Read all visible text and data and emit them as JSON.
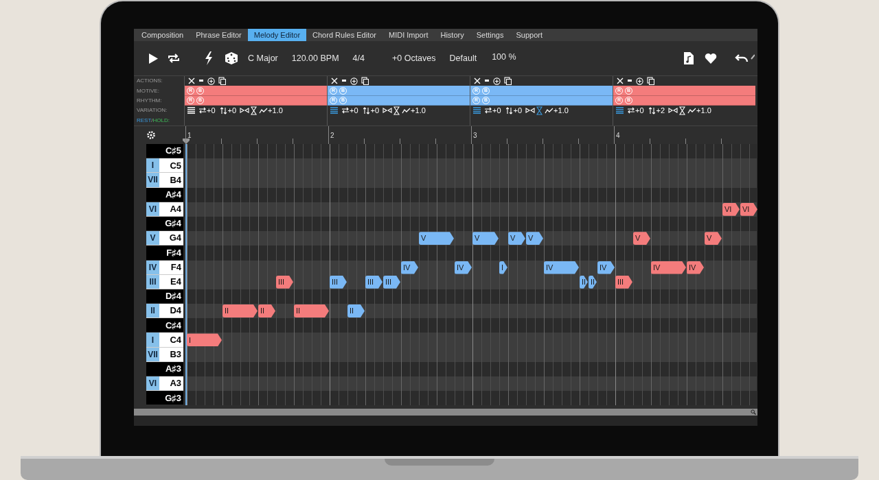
{
  "tabs": [
    {
      "label": "Composition",
      "selected": false
    },
    {
      "label": "Phrase Editor",
      "selected": false
    },
    {
      "label": "Melody Editor",
      "selected": true
    },
    {
      "label": "Chord Rules Editor",
      "selected": false
    },
    {
      "label": "MIDI Import",
      "selected": false
    },
    {
      "label": "History",
      "selected": false
    },
    {
      "label": "Settings",
      "selected": false
    },
    {
      "label": "Support",
      "selected": false
    }
  ],
  "toolbar": {
    "key": "C Major",
    "tempo": "120.00 BPM",
    "time_signature": "4/4",
    "octaves": "+0 Octaves",
    "style": "Default",
    "volume": "100 %"
  },
  "track_labels": {
    "actions": "ACTIONS:",
    "motive": "MOTIVE:",
    "rhythm": "RHYTHM:",
    "variation": "VARIATION:",
    "rest": "REST",
    "separator": "/",
    "hold": "HOLD:"
  },
  "measures": [
    {
      "number": "1",
      "color": "#f47c7c",
      "motive": [
        "R",
        "B"
      ],
      "rhythm": [
        "R",
        "B"
      ],
      "variation": {
        "list_active": false,
        "swap": "+0",
        "shift": "+0",
        "hourglass_active": false,
        "curve": "+1.0"
      }
    },
    {
      "number": "2",
      "color": "#7ab8f5",
      "motive": [
        "R",
        "B"
      ],
      "rhythm": [
        "R",
        "B"
      ],
      "variation": {
        "list_active": true,
        "swap": "+0",
        "shift": "+0",
        "hourglass_active": false,
        "curve": "+1.0"
      }
    },
    {
      "number": "3",
      "color": "#7ab8f5",
      "motive": [
        "R",
        "B"
      ],
      "rhythm": [
        "R",
        "B"
      ],
      "variation": {
        "list_active": true,
        "swap": "+0",
        "shift": "+0",
        "hourglass_active": true,
        "curve": "+1.0"
      }
    },
    {
      "number": "4",
      "color": "#f47c7c",
      "motive": [
        "R",
        "B"
      ],
      "rhythm": [
        "R",
        "B"
      ],
      "variation": {
        "list_active": true,
        "swap": "+0",
        "shift": "+2",
        "hourglass_active": false,
        "curve": "+1.0"
      }
    }
  ],
  "piano_keys": [
    {
      "note": "C♯5",
      "kind": "black"
    },
    {
      "note": "C5",
      "kind": "white",
      "degree": "I"
    },
    {
      "note": "B4",
      "kind": "white",
      "degree": "VII"
    },
    {
      "note": "A♯4",
      "kind": "black"
    },
    {
      "note": "A4",
      "kind": "white",
      "degree": "VI",
      "events": [
        {
          "kind": "measure-rest"
        },
        {
          "kind": "measure-rest"
        },
        {
          "kind": "measure-rest"
        },
        {
          "kind": "half-rest"
        },
        {
          "kind": "quarter-rest"
        },
        {
          "kind": "eighth-note",
          "label": "VI",
          "color": "#f47c7c"
        },
        {
          "kind": "eighth-note",
          "label": "VI",
          "color": "#f47c7c"
        }
      ]
    },
    {
      "note": "G♯4",
      "kind": "black"
    },
    {
      "note": "G4",
      "kind": "white",
      "degree": "V",
      "events": [
        {
          "kind": "measure-rest"
        },
        {
          "kind": "half-rest"
        },
        {
          "kind": "eighth-rest"
        },
        {
          "kind": "quarter-note",
          "label": "V",
          "color": "#7ab8f5"
        },
        {
          "kind": "eighth-rest"
        },
        {
          "kind": "dotted-eighth-note",
          "label": "V",
          "color": "#7ab8f5"
        },
        {
          "kind": "sixteenth-rest"
        },
        {
          "kind": "eighth-note",
          "label": "V",
          "color": "#7ab8f5"
        },
        {
          "kind": "eighth-note",
          "label": "V",
          "color": "#7ab8f5"
        },
        {
          "kind": "half-rest"
        },
        {
          "kind": "eighth-rest"
        },
        {
          "kind": "eighth-note",
          "label": "V",
          "color": "#f47c7c"
        },
        {
          "kind": "quarter-rest"
        },
        {
          "kind": "eighth-rest"
        },
        {
          "kind": "eighth-note",
          "label": "V",
          "color": "#f47c7c"
        }
      ]
    },
    {
      "note": "F♯4",
      "kind": "black"
    },
    {
      "note": "F4",
      "kind": "white",
      "degree": "IV",
      "events": [
        {
          "kind": "measure-rest"
        },
        {
          "kind": "half-rest"
        },
        {
          "kind": "eighth-note",
          "label": "IV",
          "color": "#7ab8f5"
        },
        {
          "kind": "quarter-rest"
        },
        {
          "kind": "eighth-note",
          "label": "IV",
          "color": "#7ab8f5"
        },
        {
          "kind": "eighth-rest"
        },
        {
          "kind": "sixteenth-rest"
        },
        {
          "kind": "sixteenth-note",
          "label": "I",
          "color": "#7ab8f5"
        },
        {
          "kind": "quarter-rest"
        },
        {
          "kind": "quarter-note",
          "label": "IV",
          "color": "#7ab8f5"
        },
        {
          "kind": "eighth-rest"
        },
        {
          "kind": "eighth-note",
          "label": "IV",
          "color": "#7ab8f5"
        },
        {
          "kind": "quarter-rest"
        },
        {
          "kind": "quarter-note",
          "label": "IV",
          "color": "#f47c7c"
        },
        {
          "kind": "eighth-note",
          "label": "IV",
          "color": "#f47c7c"
        }
      ]
    },
    {
      "note": "E4",
      "kind": "white",
      "degree": "III",
      "events": [
        {
          "kind": "half-rest"
        },
        {
          "kind": "eighth-rest"
        },
        {
          "kind": "eighth-note",
          "label": "III",
          "color": "#f47c7c"
        },
        {
          "kind": "quarter-rest"
        },
        {
          "kind": "eighth-note",
          "label": "III",
          "color": "#7ab8f5"
        },
        {
          "kind": "eighth-rest"
        },
        {
          "kind": "eighth-note",
          "label": "III",
          "color": "#7ab8f5"
        },
        {
          "kind": "eighth-note",
          "label": "III",
          "color": "#7ab8f5"
        },
        {
          "kind": "measure-rest"
        },
        {
          "kind": "quarter-rest"
        },
        {
          "kind": "sixteenth-note",
          "label": "II",
          "color": "#7ab8f5"
        },
        {
          "kind": "sixteenth-note",
          "label": "II",
          "color": "#7ab8f5"
        },
        {
          "kind": "eighth-rest"
        },
        {
          "kind": "eighth-note",
          "label": "III",
          "color": "#f47c7c"
        }
      ]
    },
    {
      "note": "D♯4",
      "kind": "black"
    },
    {
      "note": "D4",
      "kind": "white",
      "degree": "II",
      "events": [
        {
          "kind": "quarter-rest"
        },
        {
          "kind": "quarter-note",
          "label": "II",
          "color": "#f47c7c"
        },
        {
          "kind": "eighth-note",
          "label": "II",
          "color": "#f47c7c"
        },
        {
          "kind": "eighth-rest"
        },
        {
          "kind": "quarter-note",
          "label": "II",
          "color": "#f47c7c"
        },
        {
          "kind": "eighth-rest"
        },
        {
          "kind": "eighth-note",
          "label": "II",
          "color": "#7ab8f5"
        }
      ]
    },
    {
      "note": "C♯4",
      "kind": "black"
    },
    {
      "note": "C4",
      "kind": "white",
      "degree": "I",
      "events": [
        {
          "kind": "quarter-note",
          "label": "I",
          "color": "#f47c7c"
        }
      ]
    },
    {
      "note": "B3",
      "kind": "white",
      "degree": "VII"
    },
    {
      "note": "A♯3",
      "kind": "black"
    },
    {
      "note": "A3",
      "kind": "white",
      "degree": "VI"
    },
    {
      "note": "G♯3",
      "kind": "black"
    }
  ]
}
